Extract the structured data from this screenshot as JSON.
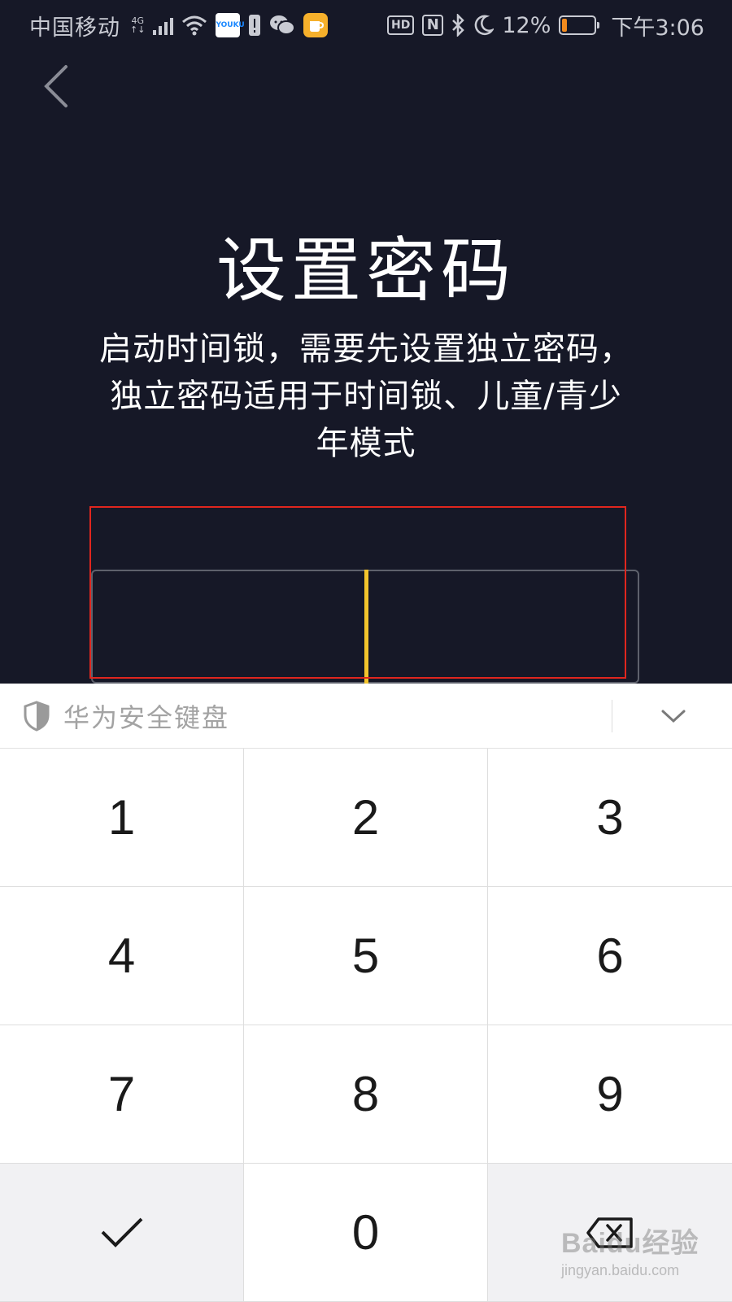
{
  "status_bar": {
    "carrier": "中国移动",
    "network": "4G",
    "network_sub": "↑↓",
    "youku_badge": "YOUKU",
    "battery_percent": "12%",
    "battery_level": 0.12,
    "time": "下午3:06",
    "hd_label": "HD",
    "nfc_label": "N"
  },
  "page": {
    "title": "设置密码",
    "description": "启动时间锁，需要先设置独立密码，独立密码适用于时间锁、儿童/青少年模式"
  },
  "colors": {
    "background": "#161827",
    "cursor": "#f3c42c",
    "highlight": "#e0261e",
    "battery": "#f28a1e"
  },
  "keyboard": {
    "title": "华为安全键盘",
    "keys": [
      "1",
      "2",
      "3",
      "4",
      "5",
      "6",
      "7",
      "8",
      "9",
      "0"
    ],
    "confirm_icon": "check-icon",
    "delete_icon": "backspace-icon",
    "collapse_icon": "chevron-down-icon",
    "shield_icon": "shield-icon"
  },
  "watermark": {
    "brand": "Baidu经验",
    "url": "jingyan.baidu.com"
  }
}
